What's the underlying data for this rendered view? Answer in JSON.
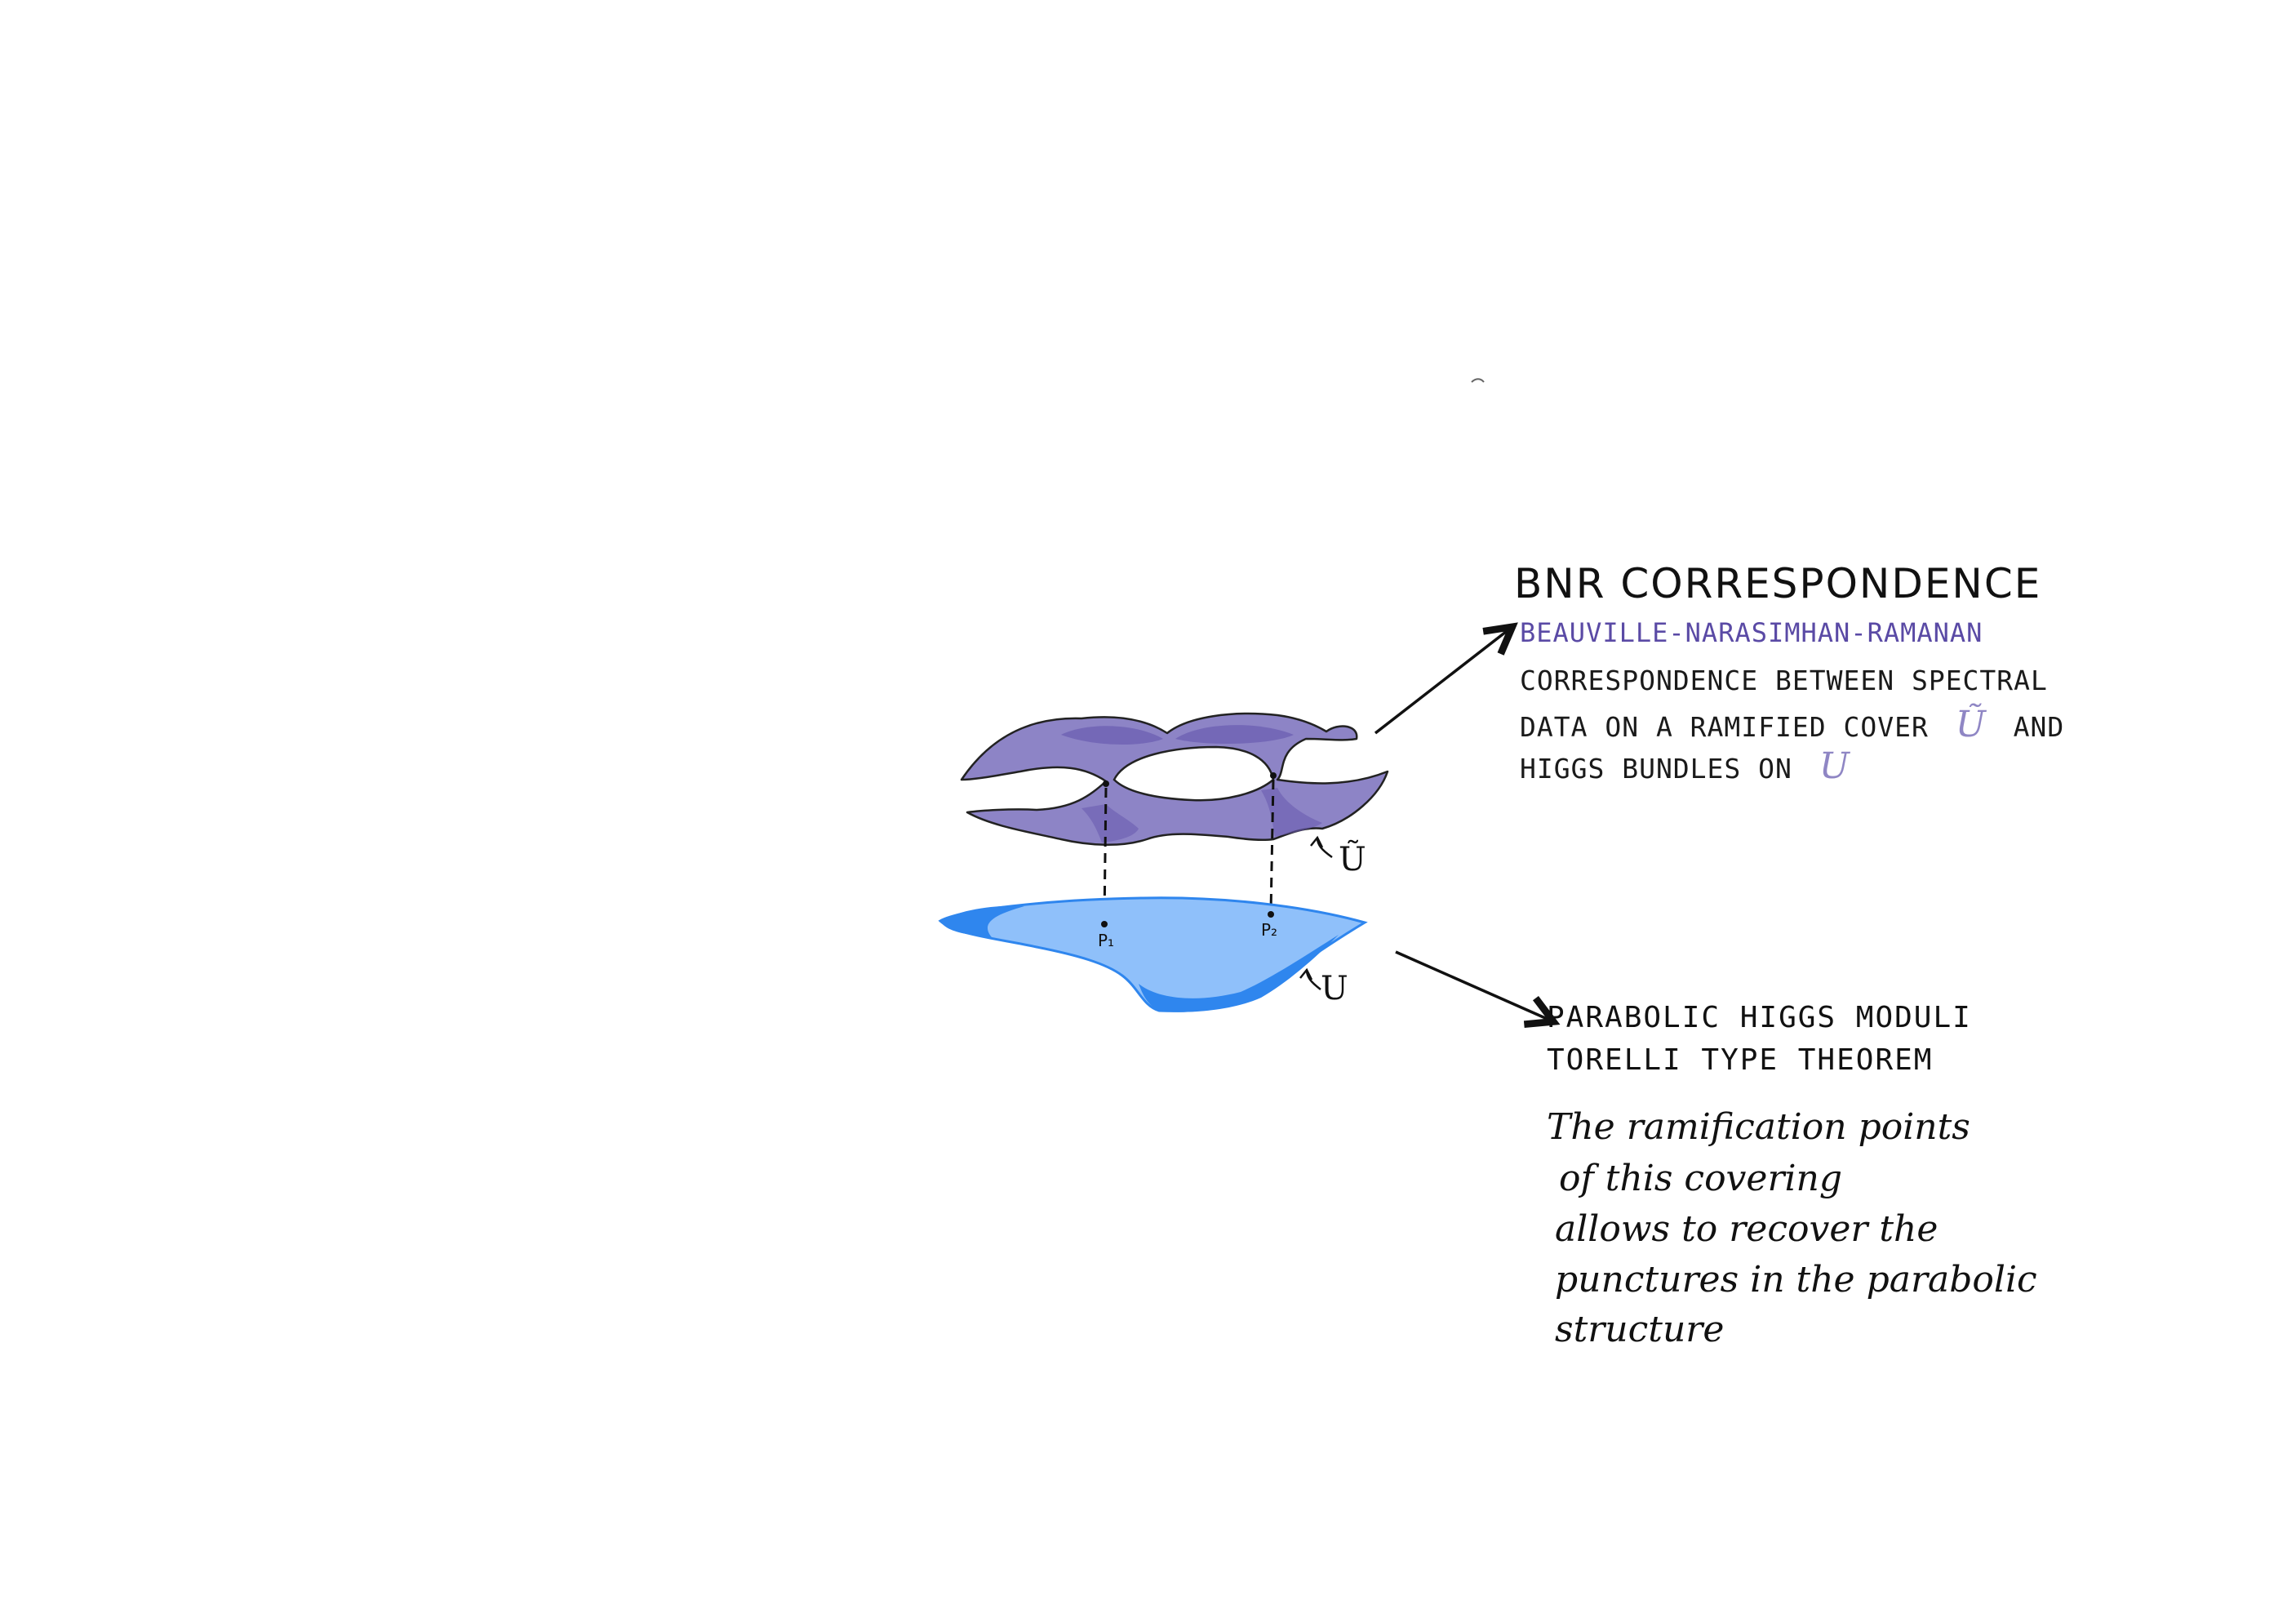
{
  "header": {
    "title": "BNR CORRESPONDENCE",
    "subtitle": "BEAUVILLE-NARASIMHAN-RAMANAN"
  },
  "description": {
    "line1": "CORRESPONDENCE BETWEEN SPECTRAL",
    "line2_text": "DATA ON A RAMIFIED COVER",
    "line2_symbol": "Ũ",
    "line2_end": "AND",
    "line3_text": "HIGGS BUNDLES ON",
    "line3_symbol": "U"
  },
  "right_section": {
    "title_line1": "PARABOLIC HIGGS MODULI",
    "title_line2": "TORELLI TYPE THEOREM",
    "note_lines": [
      "The ramification points",
      "of this covering",
      "allows to recover the",
      "punctures in the parabolic",
      "structure"
    ]
  },
  "diagram": {
    "upper_surface_label": "Ũ",
    "lower_surface_label": "U",
    "point_labels": [
      "P₁",
      "P₂"
    ]
  },
  "colors": {
    "upper_fill": "#8d84c6",
    "upper_dark": "#6a5cb0",
    "lower_fill": "#8fc0fa",
    "lower_dark": "#2f86ee",
    "subtitle": "#5a4aa5",
    "accent": "#8f86c4"
  }
}
